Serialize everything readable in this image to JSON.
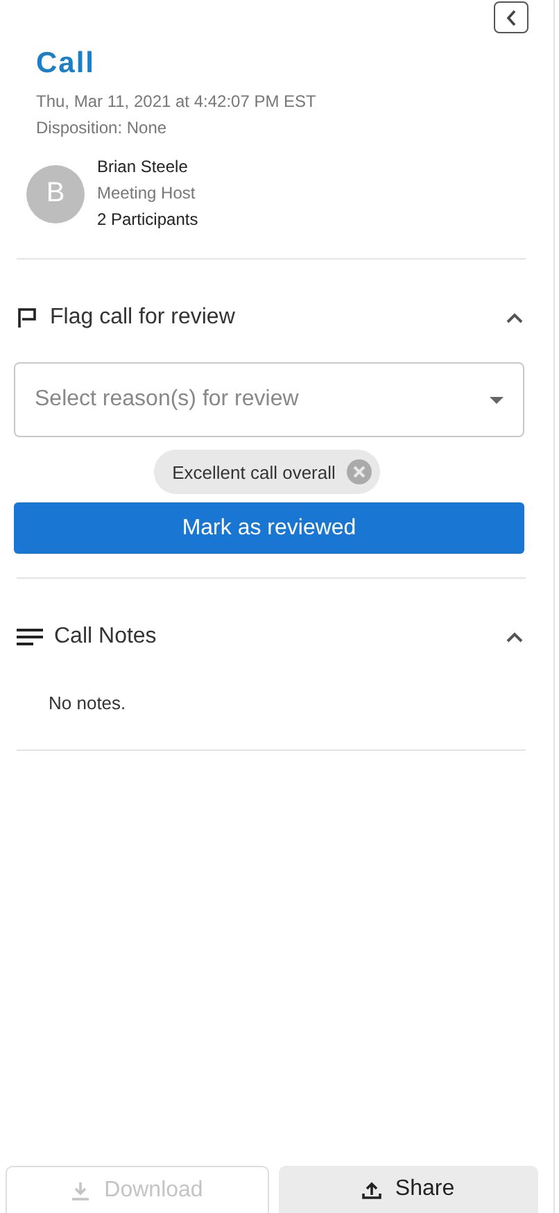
{
  "header": {
    "title": "Call",
    "date": "Thu, Mar 11, 2021 at 4:42:07 PM EST",
    "disposition": "Disposition: None"
  },
  "host": {
    "initial": "B",
    "name": "Brian Steele",
    "role": "Meeting Host",
    "participants": "2 Participants"
  },
  "flag_section": {
    "title": "Flag call for review",
    "expanded": true,
    "select": {
      "placeholder": "Select reason(s) for review"
    },
    "chips": [
      "Excellent call overall"
    ],
    "button": "Mark as reviewed"
  },
  "notes_section": {
    "title": "Call Notes",
    "expanded": true,
    "body": "No notes."
  },
  "footer_buttons": [
    {
      "kind": "download",
      "label": "Download",
      "disabled": true
    },
    {
      "kind": "share",
      "label": "Share",
      "disabled": false
    }
  ]
}
